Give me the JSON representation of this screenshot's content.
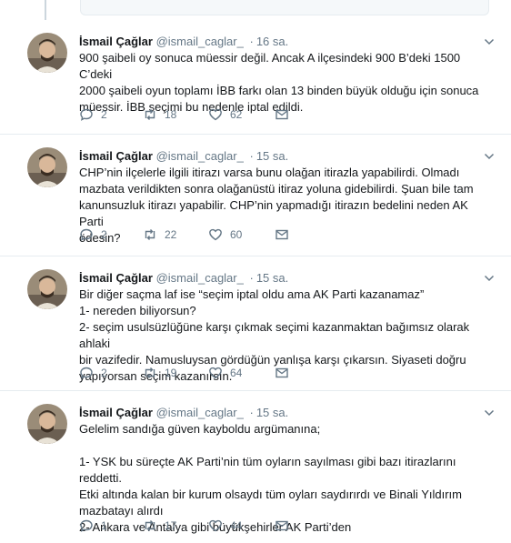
{
  "colors": {
    "accent": "#1da1f2",
    "muted": "#657786",
    "text": "#14171a",
    "divider": "#e6ecf0"
  },
  "tweets": [
    {
      "fullname": "İsmail Çağlar",
      "username": "@ismail_caglar_",
      "separator": "·",
      "time": "16 sa.",
      "text": "900 şaibeli oy sonuca müessir değil. Ancak A ilçesindeki 900 B’deki 1500 C’deki\n2000 şaibeli oyun toplamı İBB farkı olan 13 binden büyük olduğu için sonuca\nmüessir. İBB seçimi bu nedenle iptal edildi.",
      "replies": "2",
      "retweets": "18",
      "likes": "62"
    },
    {
      "fullname": "İsmail Çağlar",
      "username": "@ismail_caglar_",
      "separator": "·",
      "time": "15 sa.",
      "text": "CHP’nin ilçelerle ilgili itirazı varsa bunu olağan itirazla yapabilirdi. Olmadı\nmazbata verildikten sonra olağanüstü itiraz yoluna gidebilirdi. Şuan bile tam\nkanunsuzluk itirazı yapabilir. CHP’nin yapmadığı itirazın bedelini neden AK Parti\nödesin?",
      "replies": "2",
      "retweets": "22",
      "likes": "60"
    },
    {
      "fullname": "İsmail Çağlar",
      "username": "@ismail_caglar_",
      "separator": "·",
      "time": "15 sa.",
      "text": "Bir diğer saçma laf ise “seçim iptal oldu ama AK Parti kazanamaz”\n1- nereden biliyorsun?\n2- seçim usulsüzlüğüne karşı çıkmak seçimi kazanmaktan bağımsız olarak ahlaki\nbir vazifedir. Namusluysan gördüğün yanlışa karşı çıkarsın. Siyaseti doğru\nyapıyorsan seçim kazanırsın.",
      "replies": "2",
      "retweets": "19",
      "likes": "64"
    },
    {
      "fullname": "İsmail Çağlar",
      "username": "@ismail_caglar_",
      "separator": "·",
      "time": "15 sa.",
      "text": "Gelelim sandığa güven kayboldu argümanına;\n\n1- YSK bu süreçte AK Parti’nin tüm oyların sayılması gibi bazı itirazlarını reddetti.\nEtki altında kalan bir kurum olsaydı tüm oyları saydırırdı ve Binali Yıldırım\nmazbatayı alırdı\n2- Ankara ve Antalya gibi büyükşehirler AK Parti’den",
      "replies": "1",
      "retweets": "17",
      "likes": "44"
    }
  ]
}
